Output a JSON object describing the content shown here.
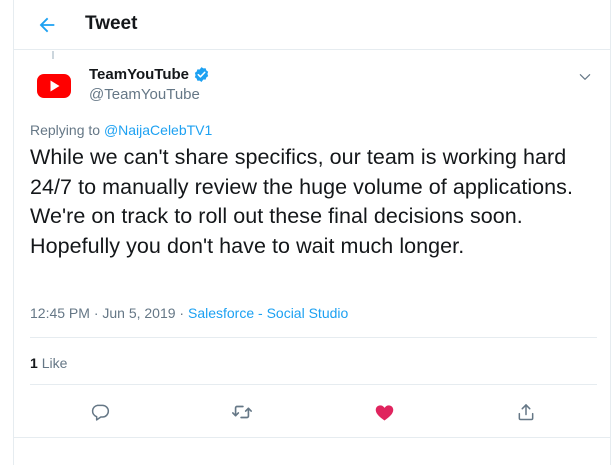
{
  "header": {
    "title": "Tweet",
    "back_icon": "arrow-left-icon"
  },
  "author": {
    "display_name": "TeamYouTube",
    "handle": "@TeamYouTube",
    "verified": true,
    "avatar_icon": "youtube-logo-icon"
  },
  "tweet": {
    "replying_prefix": "Replying to",
    "replying_to": "@NaijaCelebTV1",
    "text": "While we can't share specifics, our team is working hard 24/7 to manually review the huge volume of applications. We're on track to roll out these final decisions soon. Hopefully you don't have to wait much longer.",
    "timestamp": "12:45 PM · Jun 5, 2019 · ",
    "source": "Salesforce - Social Studio"
  },
  "stats": {
    "like_count": "1",
    "like_label": "Like"
  },
  "actions": [
    "reply-icon",
    "retweet-icon",
    "like-icon",
    "share-icon"
  ],
  "colors": {
    "accent": "#1da1f2",
    "like_active": "#e0245e",
    "youtube_red": "#ff0000",
    "secondary_text": "#657786",
    "border": "#e6ecf0"
  }
}
